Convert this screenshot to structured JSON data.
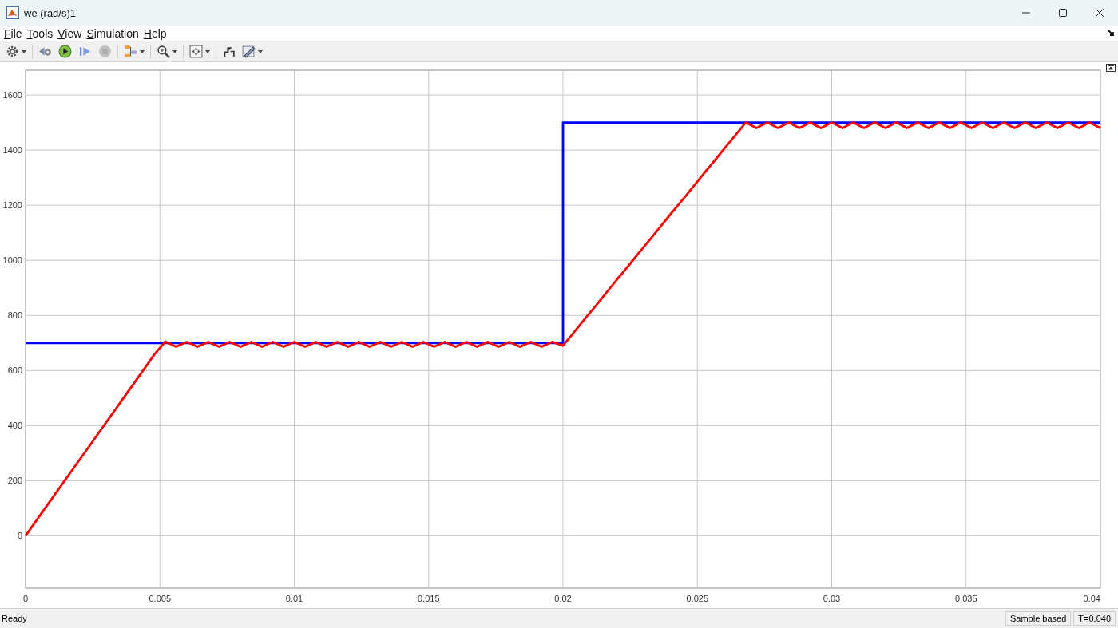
{
  "window": {
    "title": "we (rad/s)1"
  },
  "menu": [
    "File",
    "Tools",
    "View",
    "Simulation",
    "Help"
  ],
  "toolbar": [
    {
      "kind": "settings",
      "menu": true,
      "disabled": false
    },
    {
      "kind": "step-back",
      "menu": false,
      "disabled": false
    },
    {
      "kind": "run",
      "menu": false,
      "disabled": false
    },
    {
      "kind": "step-forward",
      "menu": false,
      "disabled": false
    },
    {
      "kind": "stop",
      "menu": false,
      "disabled": true
    },
    {
      "kind": "highlight",
      "menu": true,
      "disabled": false
    },
    {
      "kind": "zoom",
      "menu": true,
      "disabled": false
    },
    {
      "kind": "autoscale",
      "menu": true,
      "disabled": false
    },
    {
      "kind": "layout",
      "menu": false,
      "disabled": false
    },
    {
      "kind": "style",
      "menu": true,
      "disabled": false
    }
  ],
  "plot": {
    "chart_data": {
      "type": "line",
      "x": [
        0,
        0.0004,
        0.0008,
        0.0012,
        0.0016,
        0.002,
        0.0024,
        0.0028,
        0.0032,
        0.0036,
        0.004,
        0.0044,
        0.0048,
        0.0052,
        0.0056,
        0.006,
        0.0064,
        0.0068,
        0.0072,
        0.0076,
        0.008,
        0.0084,
        0.0088,
        0.0092,
        0.0096,
        0.01,
        0.0104,
        0.0108,
        0.0112,
        0.0116,
        0.012,
        0.0124,
        0.0128,
        0.0132,
        0.0136,
        0.014,
        0.0144,
        0.0148,
        0.0152,
        0.0156,
        0.016,
        0.0164,
        0.0168,
        0.0172,
        0.0176,
        0.018,
        0.0184,
        0.0188,
        0.0192,
        0.0196,
        0.02,
        0.02,
        0.0204,
        0.0208,
        0.0212,
        0.0216,
        0.022,
        0.0224,
        0.0228,
        0.0232,
        0.0236,
        0.024,
        0.0244,
        0.0248,
        0.0252,
        0.0256,
        0.026,
        0.0264,
        0.0268,
        0.0272,
        0.0276,
        0.028,
        0.0284,
        0.0288,
        0.0292,
        0.0296,
        0.03,
        0.0304,
        0.0308,
        0.0312,
        0.0316,
        0.032,
        0.0324,
        0.0328,
        0.0332,
        0.0336,
        0.034,
        0.0344,
        0.0348,
        0.0352,
        0.0356,
        0.036,
        0.0364,
        0.0368,
        0.0372,
        0.0376,
        0.038,
        0.0384,
        0.0388,
        0.0392,
        0.0396,
        0.04
      ],
      "series": [
        {
          "color": "#0000ff",
          "values": [
            700,
            700,
            700,
            700,
            700,
            700,
            700,
            700,
            700,
            700,
            700,
            700,
            700,
            700,
            700,
            700,
            700,
            700,
            700,
            700,
            700,
            700,
            700,
            700,
            700,
            700,
            700,
            700,
            700,
            700,
            700,
            700,
            700,
            700,
            700,
            700,
            700,
            700,
            700,
            700,
            700,
            700,
            700,
            700,
            700,
            700,
            700,
            700,
            700,
            700,
            700,
            1500,
            1500,
            1500,
            1500,
            1500,
            1500,
            1500,
            1500,
            1500,
            1500,
            1500,
            1500,
            1500,
            1500,
            1500,
            1500,
            1500,
            1500,
            1500,
            1500,
            1500,
            1500,
            1500,
            1500,
            1500,
            1500,
            1500,
            1500,
            1500,
            1500,
            1500,
            1500,
            1500,
            1500,
            1500,
            1500,
            1500,
            1500,
            1500,
            1500,
            1500,
            1500,
            1500,
            1500,
            1500,
            1500,
            1500,
            1500,
            1500,
            1500,
            1500
          ]
        },
        {
          "color": "#ff0000",
          "values": [
            0,
            55,
            110,
            165,
            220,
            275,
            329,
            384,
            439,
            494,
            549,
            604,
            659,
            705,
            686,
            704,
            686,
            704,
            686,
            704,
            686,
            704,
            686,
            704,
            686,
            704,
            686,
            704,
            686,
            704,
            686,
            704,
            686,
            704,
            686,
            704,
            686,
            704,
            686,
            704,
            686,
            704,
            686,
            704,
            686,
            704,
            686,
            704,
            686,
            704,
            690,
            690,
            738,
            786,
            833,
            881,
            929,
            976,
            1024,
            1071,
            1119,
            1167,
            1214,
            1262,
            1310,
            1357,
            1405,
            1452,
            1500,
            1480,
            1500,
            1480,
            1500,
            1480,
            1500,
            1480,
            1500,
            1480,
            1500,
            1480,
            1500,
            1480,
            1500,
            1480,
            1500,
            1480,
            1500,
            1480,
            1500,
            1480,
            1500,
            1480,
            1500,
            1480,
            1500,
            1480,
            1500,
            1480,
            1500,
            1480,
            1500,
            1480
          ]
        }
      ],
      "grid": true,
      "xlim": [
        0,
        0.04
      ],
      "ylim": [
        -190,
        1690
      ],
      "xticks": [
        0,
        0.005,
        0.01,
        0.015,
        0.02,
        0.025,
        0.03,
        0.035,
        0.04
      ],
      "yticks": [
        0,
        200,
        400,
        600,
        800,
        1000,
        1200,
        1400,
        1600
      ]
    }
  },
  "status_bar": {
    "status": "Ready",
    "mode": "Sample based",
    "time": "T=0.040"
  }
}
